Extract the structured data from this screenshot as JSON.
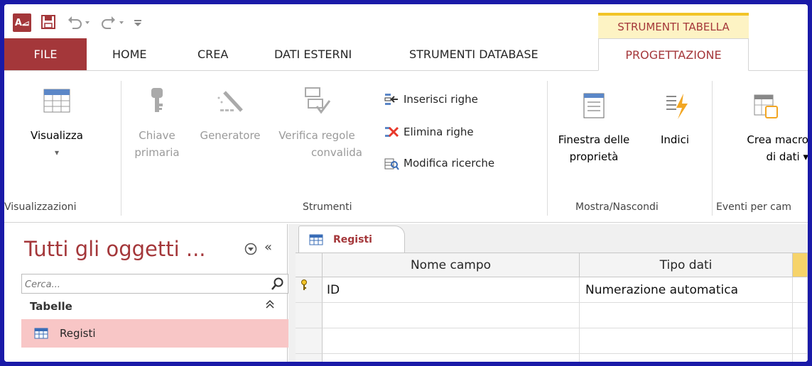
{
  "titlebar": {
    "app_logo": "A⧡",
    "context_tab": "STRUMENTI TABELLA"
  },
  "tabs": [
    {
      "label": "FILE"
    },
    {
      "label": "HOME"
    },
    {
      "label": "CREA"
    },
    {
      "label": "DATI ESTERNI"
    },
    {
      "label": "STRUMENTI DATABASE"
    },
    {
      "label": "PROGETTAZIONE"
    }
  ],
  "ribbon": {
    "visualizza": {
      "label": "Visualizza",
      "arrow": "▾"
    },
    "chiave": {
      "line1": "Chiave",
      "line2": "primaria"
    },
    "generatore": {
      "label": "Generatore"
    },
    "verifica": {
      "line1": "Verifica regole",
      "line2": "convalida"
    },
    "inserisci_righe": "Inserisci righe",
    "elimina_righe": "Elimina righe",
    "modifica_ricerche": "Modifica ricerche",
    "finestra": {
      "line1": "Finestra delle",
      "line2": "proprietà"
    },
    "indici": "Indici",
    "crea_macro": {
      "line1": "Crea macro",
      "line2": "di dati ▾"
    },
    "groups": {
      "visualizzazioni": "Visualizzazioni",
      "strumenti": "Strumenti",
      "mostra_nascondi": "Mostra/Nascondi",
      "eventi": "Eventi per cam"
    }
  },
  "nav": {
    "title": "Tutti gli oggetti ...",
    "collapse": "«",
    "search_placeholder": "Cerca...",
    "group": "Tabelle",
    "group_collapse": "≈",
    "items": [
      {
        "label": "Registi"
      }
    ]
  },
  "document": {
    "tab_label": "Registi",
    "columns": [
      "Nome campo",
      "Tipo dati"
    ],
    "rows": [
      {
        "name": "ID",
        "type": "Numerazione automatica",
        "primary_key": true
      },
      {
        "name": "",
        "type": ""
      },
      {
        "name": "",
        "type": ""
      },
      {
        "name": "",
        "type": ""
      }
    ]
  },
  "colors": {
    "access_red": "#a4373a",
    "context_yellow": "#f2c428",
    "frame_blue": "#1a1aa8",
    "selected_item": "#f8c6c6"
  }
}
